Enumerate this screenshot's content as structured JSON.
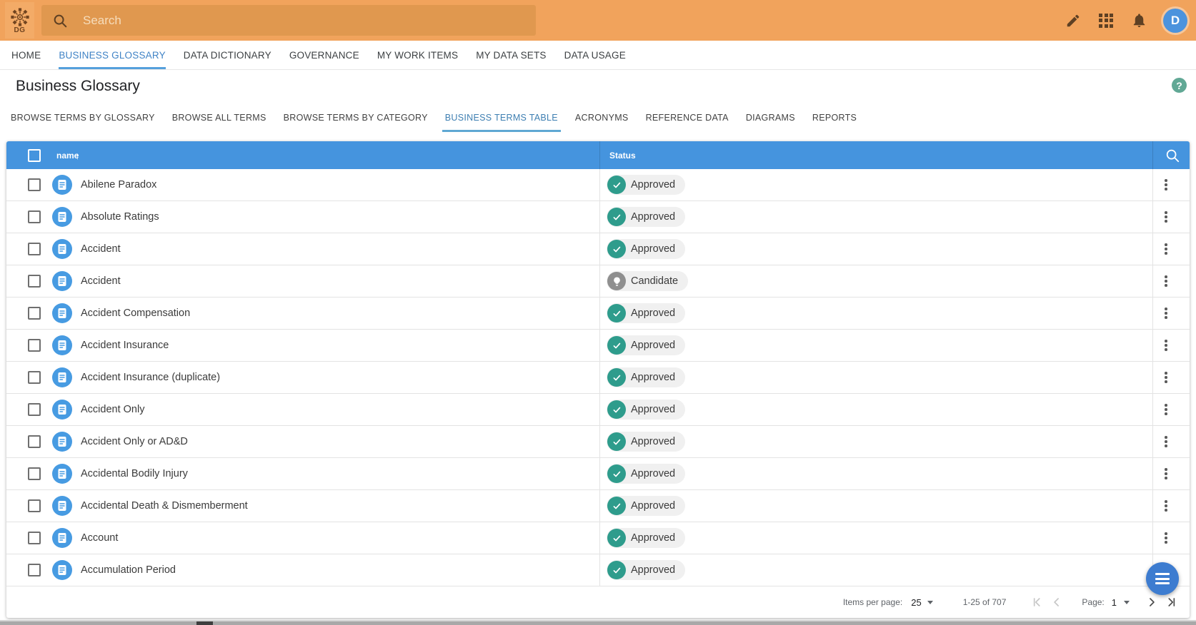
{
  "app_bar": {
    "logo_text": "DG",
    "search": {
      "placeholder": "Search"
    },
    "avatar_initial": "D"
  },
  "nav_tabs": [
    {
      "label": "HOME",
      "active": false
    },
    {
      "label": "BUSINESS GLOSSARY",
      "active": true
    },
    {
      "label": "DATA DICTIONARY",
      "active": false
    },
    {
      "label": "GOVERNANCE",
      "active": false
    },
    {
      "label": "MY WORK ITEMS",
      "active": false
    },
    {
      "label": "MY DATA SETS",
      "active": false
    },
    {
      "label": "DATA USAGE",
      "active": false
    }
  ],
  "page": {
    "title": "Business Glossary",
    "help_label": "?"
  },
  "sub_tabs": [
    {
      "label": "BROWSE TERMS BY GLOSSARY",
      "active": false
    },
    {
      "label": "BROWSE ALL TERMS",
      "active": false
    },
    {
      "label": "BROWSE TERMS BY CATEGORY",
      "active": false
    },
    {
      "label": "BUSINESS TERMS TABLE",
      "active": true
    },
    {
      "label": "ACRONYMS",
      "active": false
    },
    {
      "label": "REFERENCE DATA",
      "active": false
    },
    {
      "label": "DIAGRAMS",
      "active": false
    },
    {
      "label": "REPORTS",
      "active": false
    }
  ],
  "table": {
    "columns": [
      {
        "label": "name",
        "sorted": "asc"
      },
      {
        "label": "Status"
      }
    ],
    "rows": [
      {
        "name": "Abilene Paradox",
        "status": "Approved"
      },
      {
        "name": "Absolute Ratings",
        "status": "Approved"
      },
      {
        "name": "Accident",
        "status": "Approved"
      },
      {
        "name": "Accident",
        "status": "Candidate"
      },
      {
        "name": "Accident Compensation",
        "status": "Approved"
      },
      {
        "name": "Accident Insurance",
        "status": "Approved"
      },
      {
        "name": "Accident Insurance (duplicate)",
        "status": "Approved"
      },
      {
        "name": "Accident Only",
        "status": "Approved"
      },
      {
        "name": "Accident Only or AD&D",
        "status": "Approved"
      },
      {
        "name": "Accidental Bodily Injury",
        "status": "Approved"
      },
      {
        "name": "Accidental Death & Dismemberment",
        "status": "Approved"
      },
      {
        "name": "Account",
        "status": "Approved"
      },
      {
        "name": "Accumulation Period",
        "status": "Approved"
      }
    ],
    "status_styles": {
      "Approved": {
        "color": "#2E9C8C",
        "icon": "check-icon"
      },
      "Candidate": {
        "color": "#8F8F8F",
        "icon": "lightbulb-icon"
      }
    }
  },
  "pagination": {
    "items_per_page_label": "Items per page:",
    "items_per_page_value": "25",
    "range": "1-25 of 707",
    "page_label": "Page:",
    "page_value": "1"
  },
  "colors": {
    "app_bar": "#F1A35C",
    "table_header": "#4594DE",
    "accent_blue": "#55A0DC",
    "approved": "#2E9C8C",
    "candidate": "#8F8F8F",
    "fab": "#3D7CD0",
    "help": "#61A895"
  }
}
